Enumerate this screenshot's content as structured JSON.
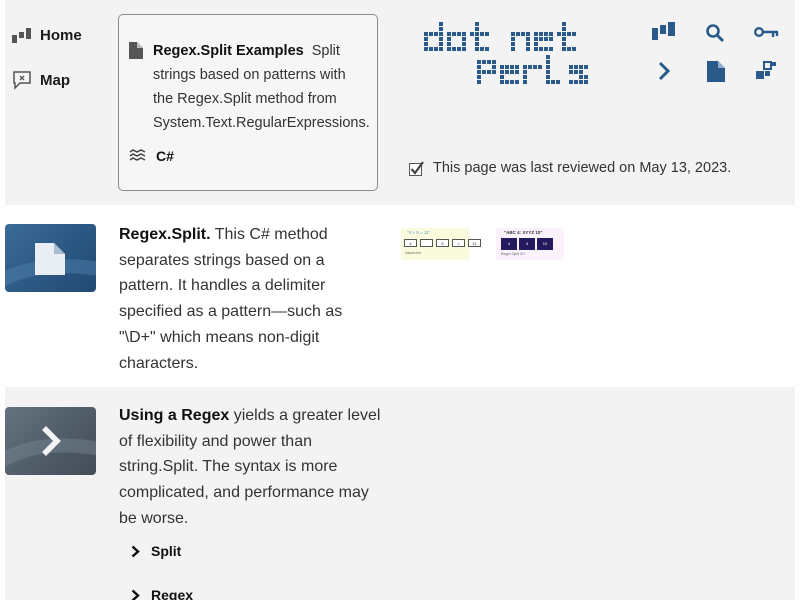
{
  "nav": {
    "home_label": "Home",
    "map_label": "Map"
  },
  "card": {
    "title": "Regex.Split Examples",
    "description": "Split strings based on patterns with the Regex.Split method from System.Text.RegularExpressions.",
    "language": "C#"
  },
  "logo": {
    "line1": "dot net",
    "line2": "perls"
  },
  "toolbar": {
    "icons": [
      "bars-icon",
      "search-icon",
      "key-icon",
      "chevron-right-icon",
      "document-icon",
      "blocks-icon"
    ],
    "color": "#2a5a8a"
  },
  "review": {
    "text": "This page was last reviewed on May 13, 2023."
  },
  "section1": {
    "lead": "Regex.Split.",
    "text": " This C# method separates strings based on a pattern. It handles a delimiter specified as a pattern—such as \"\\D+\" which means non-digit characters.",
    "mini1": {
      "title": "\"4 + 5 = 11\"",
      "cells": [
        "4",
        "",
        "5",
        "=",
        "11"
      ],
      "caption": "Values list"
    },
    "mini2": {
      "title": "\"ABC 4: XYYZ 10\"",
      "cells": [
        "4",
        "4",
        "10"
      ],
      "caption": "Regex.Split \\D+"
    }
  },
  "section2": {
    "lead": "Using a Regex",
    "text": " yields a greater level of flexibility and power than string.Split. The syntax is more complicated, and performance may be worse.",
    "links": [
      "Split",
      "Regex"
    ]
  },
  "colors": {
    "brand": "#1f4e79",
    "band": "#f3f3f3"
  }
}
